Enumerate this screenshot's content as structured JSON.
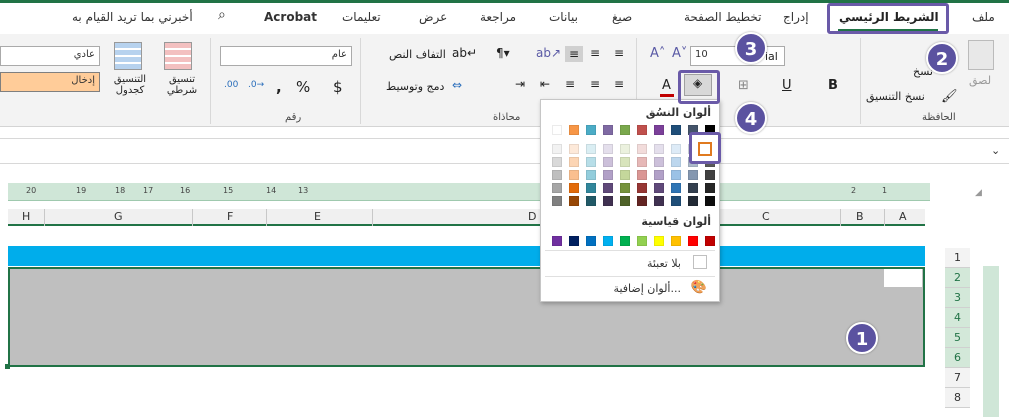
{
  "tabs": [
    {
      "id": "file",
      "label": "ملف"
    },
    {
      "id": "home",
      "label": "الشريط الرئيسي"
    },
    {
      "id": "insert",
      "label": "إدراج"
    },
    {
      "id": "layout",
      "label": "تخطيط الصفحة"
    },
    {
      "id": "formulas",
      "label": "صيغ"
    },
    {
      "id": "data",
      "label": "بيانات"
    },
    {
      "id": "review",
      "label": "مراجعة"
    },
    {
      "id": "view",
      "label": "عرض"
    },
    {
      "id": "help",
      "label": "تعليمات"
    },
    {
      "id": "acrobat",
      "label": "Acrobat"
    },
    {
      "id": "tellme",
      "label": "أخبرني بما تريد القيام به"
    }
  ],
  "ribbon": {
    "clipboard": {
      "group_label": "الحافظة",
      "paste_label": "لصق",
      "copy_label": "نسخ",
      "format_painter_label": "نسخ التنسيق"
    },
    "font": {
      "font_size": "10",
      "font_name_partial": "ial",
      "bold": "B",
      "underline": "U"
    },
    "alignment": {
      "group_label": "محاذاة",
      "wrap_text": "التفاف النص",
      "merge_center": "دمج وتوسيط"
    },
    "number": {
      "group_label": "رقم",
      "format_value": "عام"
    },
    "styles": {
      "conditional": "تنسيق شرطي",
      "as_table": "التنسيق كجدول",
      "normal": "عادي",
      "input": "إدخال"
    }
  },
  "ruler_ticks": [
    "20",
    "19",
    "18",
    "17",
    "16",
    "15",
    "14",
    "13",
    "2",
    "1"
  ],
  "columns": [
    "H",
    "G",
    "F",
    "E",
    "D",
    "C",
    "B",
    "A"
  ],
  "rows": [
    "1",
    "2",
    "3",
    "4",
    "5",
    "6",
    "7",
    "8"
  ],
  "color_panel": {
    "theme_title": "ألوان النسُق",
    "standard_title": "ألوان قياسية",
    "no_fill": "بلا تعبئة",
    "more_colors": "ألوان إضافية..."
  },
  "badges": [
    "1",
    "2",
    "3",
    "4"
  ],
  "colors": {
    "excel_green": "#217346",
    "highlight": "#6a5aa8",
    "blue_band": "#00adeb",
    "grey_fill": "#bfbfbf"
  }
}
